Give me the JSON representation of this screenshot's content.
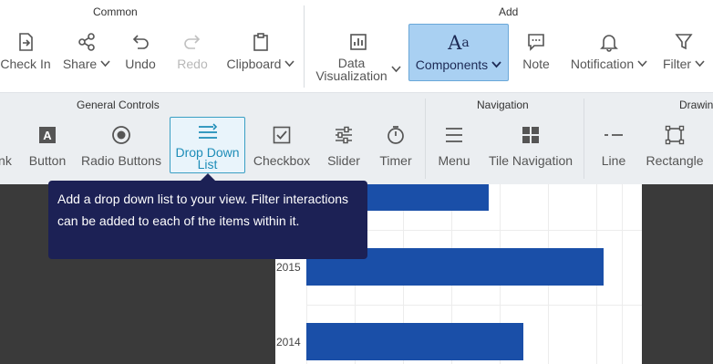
{
  "ribbon_top": {
    "groups": {
      "common": "Common",
      "add": "Add"
    },
    "buttons": {
      "check_in": "Check In",
      "share": "Share",
      "undo": "Undo",
      "redo": "Redo",
      "clipboard": "Clipboard",
      "data_visualization_line1": "Data",
      "data_visualization_line2": "Visualization",
      "components": "Components",
      "note": "Note",
      "notification": "Notification",
      "filter": "Filter"
    }
  },
  "ribbon_second": {
    "groups": {
      "general_controls": "General Controls",
      "navigation": "Navigation",
      "drawing": "Drawing"
    },
    "buttons": {
      "link": "Link",
      "button": "Button",
      "radio_buttons": "Radio Buttons",
      "drop_down_line1": "Drop Down",
      "drop_down_line2": "List",
      "checkbox": "Checkbox",
      "slider": "Slider",
      "timer": "Timer",
      "menu": "Menu",
      "tile_navigation": "Tile Navigation",
      "line": "Line",
      "rectangle": "Rectangle"
    }
  },
  "tooltip": {
    "text": "Add a drop down list to your view. Filter interactions can be added to each of the items within it."
  },
  "chart_data": {
    "type": "bar",
    "orientation": "horizontal",
    "categories": [
      "2015",
      "2014"
    ],
    "values": [
      326,
      238
    ],
    "partial_bar_above_value": 200,
    "colors": {
      "bar": "#1a4fa8"
    }
  },
  "colors": {
    "accent": "#1e8db8",
    "tooltip_bg": "#1c2155",
    "selected_top": "#a9d0f2"
  }
}
